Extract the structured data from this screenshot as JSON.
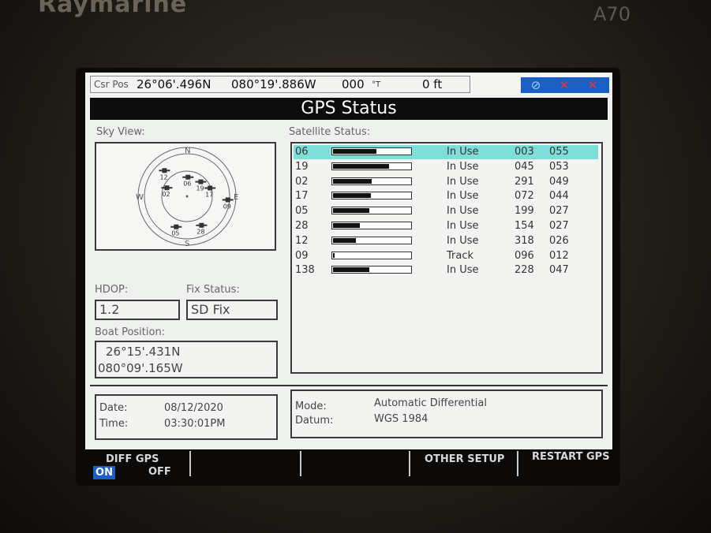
{
  "device": {
    "brand": "Raymarine",
    "model": "A70"
  },
  "cursor_bar": {
    "label": "Csr Pos",
    "latitude": "26°06'.496N",
    "longitude": "080°19'.886W",
    "heading": "000",
    "heading_unit": "°T",
    "depth": "0 ft"
  },
  "status_icons": [
    "gps-icon",
    "radar-off-icon",
    "ais-off-icon"
  ],
  "title": "GPS Status",
  "sky_view": {
    "label": "Sky View:",
    "compass": {
      "north": "N",
      "south": "S",
      "west": "W",
      "east": "E"
    },
    "satellites": [
      {
        "id": "12",
        "az": 318,
        "el": 26
      },
      {
        "id": "06",
        "az": 3,
        "el": 55
      },
      {
        "id": "19",
        "az": 45,
        "el": 53
      },
      {
        "id": "17",
        "az": 72,
        "el": 44
      },
      {
        "id": "02",
        "az": 291,
        "el": 49
      },
      {
        "id": "28",
        "az": 154,
        "el": 27
      },
      {
        "id": "05",
        "az": 199,
        "el": 27
      },
      {
        "id": "09",
        "az": 96,
        "el": 12
      }
    ]
  },
  "satellite_status": {
    "label": "Satellite Status:",
    "rows": [
      {
        "prn": "06",
        "signal": 0.55,
        "status": "In Use",
        "azimuth": "003",
        "elevation": "055",
        "selected": true
      },
      {
        "prn": "19",
        "signal": 0.71,
        "status": "In Use",
        "azimuth": "045",
        "elevation": "053",
        "selected": false
      },
      {
        "prn": "02",
        "signal": 0.49,
        "status": "In Use",
        "azimuth": "291",
        "elevation": "049",
        "selected": false
      },
      {
        "prn": "17",
        "signal": 0.48,
        "status": "In Use",
        "azimuth": "072",
        "elevation": "044",
        "selected": false
      },
      {
        "prn": "05",
        "signal": 0.46,
        "status": "In Use",
        "azimuth": "199",
        "elevation": "027",
        "selected": false
      },
      {
        "prn": "28",
        "signal": 0.34,
        "status": "In Use",
        "azimuth": "154",
        "elevation": "027",
        "selected": false
      },
      {
        "prn": "12",
        "signal": 0.29,
        "status": "In Use",
        "azimuth": "318",
        "elevation": "026",
        "selected": false
      },
      {
        "prn": "09",
        "signal": 0.02,
        "status": "Track",
        "azimuth": "096",
        "elevation": "012",
        "selected": false
      },
      {
        "prn": "138",
        "signal": 0.46,
        "status": "In Use",
        "azimuth": "228",
        "elevation": "047",
        "selected": false
      }
    ]
  },
  "hdop": {
    "label": "HDOP:",
    "value": "1.2"
  },
  "fix_status": {
    "label": "Fix Status:",
    "value": "SD Fix"
  },
  "boat_position": {
    "label": "Boat Position:",
    "latitude": "26°15'.431N",
    "longitude": "080°09'.165W"
  },
  "datetime": {
    "date_label": "Date:",
    "date": "08/12/2020",
    "time_label": "Time:",
    "time": "03:30:01PM"
  },
  "mode": {
    "mode_label": "Mode:",
    "mode": "Automatic Differential",
    "datum_label": "Datum:",
    "datum": "WGS 1984"
  },
  "softkeys": {
    "diff_gps": "DIFF GPS",
    "on": "ON",
    "off": "OFF",
    "other_setup": "OTHER SETUP",
    "restart_gps": "RESTART GPS"
  }
}
